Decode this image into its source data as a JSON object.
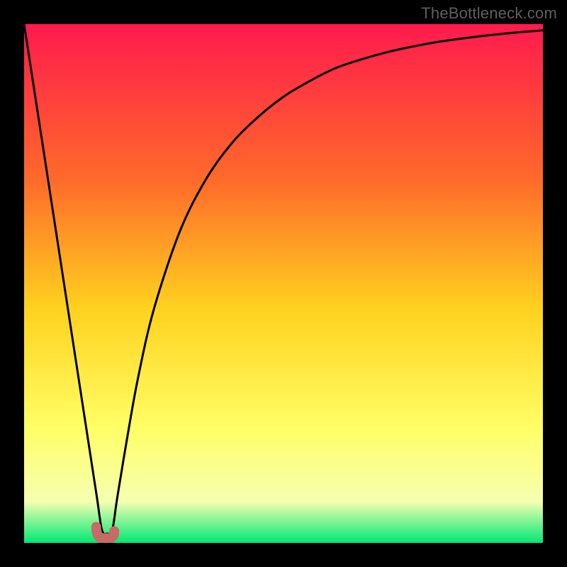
{
  "watermark": "TheBottleneck.com",
  "colors": {
    "gradient_top": "#ff1a4d",
    "gradient_mid1": "#ff6a2a",
    "gradient_mid2": "#ffd21f",
    "gradient_mid3": "#ffff66",
    "gradient_mid4": "#f6ffb0",
    "gradient_bottom": "#00e876",
    "curve": "#000000",
    "marker_fill": "#c86a66",
    "marker_stroke": "#c86a66",
    "frame": "#000000"
  },
  "chart_data": {
    "type": "line",
    "title": "",
    "xlabel": "",
    "ylabel": "",
    "xlim": [
      0,
      100
    ],
    "ylim": [
      0,
      100
    ],
    "series": [
      {
        "name": "bottleneck-curve",
        "x": [
          0,
          4,
          8,
          12,
          14,
          15,
          16,
          17,
          18,
          20,
          22,
          25,
          30,
          35,
          40,
          45,
          50,
          55,
          60,
          65,
          70,
          75,
          80,
          85,
          90,
          95,
          100
        ],
        "values": [
          100,
          74,
          48,
          22,
          9,
          2.5,
          1.8,
          2.5,
          9,
          21,
          32,
          45,
          60,
          70,
          77,
          82,
          86,
          89,
          91.5,
          93.2,
          94.6,
          95.7,
          96.6,
          97.3,
          97.9,
          98.4,
          98.8
        ]
      }
    ],
    "marker": {
      "name": "optimal-point",
      "x_range": [
        13.9,
        17.1
      ],
      "y": 2.0
    },
    "grid": false,
    "legend": false
  }
}
